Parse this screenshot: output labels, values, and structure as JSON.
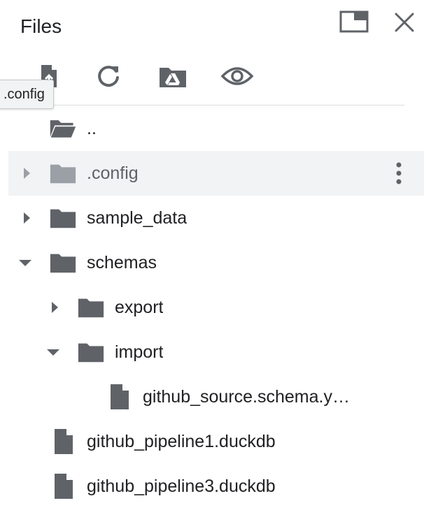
{
  "header": {
    "title": "Files"
  },
  "toolbar": {
    "tooltip": ".config",
    "buttons": [
      {
        "name": "upload-file",
        "icon": "file-upload-icon"
      },
      {
        "name": "refresh",
        "icon": "refresh-icon"
      },
      {
        "name": "mount-drive",
        "icon": "google-drive-folder-icon"
      },
      {
        "name": "show-hidden",
        "icon": "eye-icon"
      }
    ]
  },
  "tree": {
    "items": [
      {
        "label": "..",
        "type": "folder-open",
        "expanded": null
      },
      {
        "label": ".config",
        "type": "folder",
        "expanded": false,
        "hidden": true,
        "hovered": true
      },
      {
        "label": "sample_data",
        "type": "folder",
        "expanded": false
      },
      {
        "label": "schemas",
        "type": "folder",
        "expanded": true
      },
      {
        "label": "export",
        "type": "folder",
        "expanded": false
      },
      {
        "label": "import",
        "type": "folder",
        "expanded": true
      },
      {
        "label": "github_source.schema.y…",
        "type": "file"
      },
      {
        "label": "github_pipeline1.duckdb",
        "type": "file"
      },
      {
        "label": "github_pipeline3.duckdb",
        "type": "file"
      }
    ]
  },
  "colors": {
    "icon": "#5f6368",
    "hover_row": "#f1f3f4",
    "divider": "#dadce0",
    "text": "#202124"
  }
}
